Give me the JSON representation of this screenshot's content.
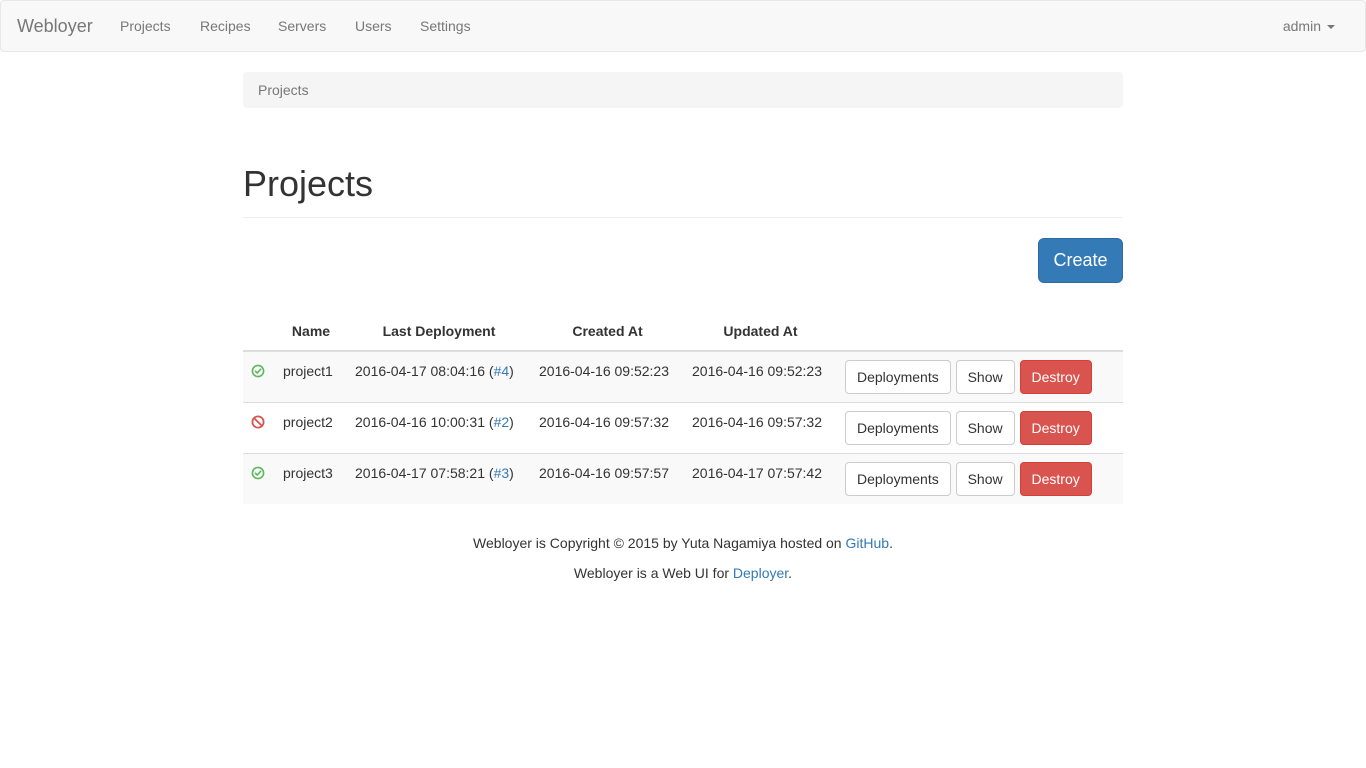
{
  "navbar": {
    "brand": "Webloyer",
    "items": [
      "Projects",
      "Recipes",
      "Servers",
      "Users",
      "Settings"
    ],
    "user": "admin"
  },
  "breadcrumb": "Projects",
  "page_title": "Projects",
  "create_label": "Create",
  "table": {
    "headers": [
      "",
      "Name",
      "Last Deployment",
      "Created At",
      "Updated At",
      ""
    ],
    "rows": [
      {
        "status": "success",
        "name": "project1",
        "last_deployment": "2016-04-17 08:04:16",
        "deployment_link": "#4",
        "created_at": "2016-04-16 09:52:23",
        "updated_at": "2016-04-16 09:52:23"
      },
      {
        "status": "failure",
        "name": "project2",
        "last_deployment": "2016-04-16 10:00:31",
        "deployment_link": "#2",
        "created_at": "2016-04-16 09:57:32",
        "updated_at": "2016-04-16 09:57:32"
      },
      {
        "status": "success",
        "name": "project3",
        "last_deployment": "2016-04-17 07:58:21",
        "deployment_link": "#3",
        "created_at": "2016-04-16 09:57:57",
        "updated_at": "2016-04-17 07:57:42"
      }
    ],
    "actions": {
      "deployments": "Deployments",
      "show": "Show",
      "destroy": "Destroy"
    }
  },
  "footer": {
    "line1_prefix": "Webloyer is Copyright © 2015 by Yuta Nagamiya hosted on ",
    "line1_link": "GitHub",
    "line1_suffix": ".",
    "line2_prefix": "Webloyer is a Web UI for ",
    "line2_link": "Deployer",
    "line2_suffix": "."
  },
  "colors": {
    "success": "#5cb85c",
    "failure": "#d9534f",
    "primary": "#337ab7"
  }
}
